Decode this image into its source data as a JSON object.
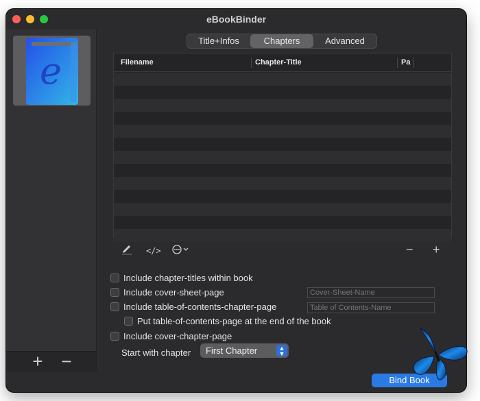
{
  "window": {
    "title": "eBookBinder"
  },
  "tabs": [
    {
      "label": "Title+Infos",
      "active": false
    },
    {
      "label": "Chapters",
      "active": true
    },
    {
      "label": "Advanced",
      "active": false
    }
  ],
  "table": {
    "columns": [
      "Filename",
      "Chapter-Title",
      "Pa"
    ],
    "rows": []
  },
  "options": {
    "chapter_titles": {
      "label": "Include chapter-titles within book",
      "checked": false
    },
    "cover_sheet": {
      "label": "Include cover-sheet-page",
      "checked": false,
      "field_placeholder": "Cover-Sheet-Name"
    },
    "toc": {
      "label": "Include table-of-contents-chapter-page",
      "checked": false,
      "field_placeholder": "Table of Contents-Name"
    },
    "toc_end": {
      "label": "Put table-of-contents-page at the end of the book",
      "checked": false
    },
    "cover_chapter": {
      "label": "Include cover-chapter-page",
      "checked": false
    }
  },
  "start_chapter": {
    "label": "Start with chapter",
    "selected": "First Chapter"
  },
  "actions": {
    "bind_label": "Bind Book"
  },
  "colors": {
    "accent": "#2a7ae4",
    "window_bg": "#2b2b2d"
  },
  "icons": {
    "table_toolbar": [
      "pencil-icon",
      "code-icon",
      "more-options-icon",
      "minus-icon",
      "plus-icon"
    ],
    "sidebar": [
      "plus-icon",
      "minus-icon"
    ]
  }
}
